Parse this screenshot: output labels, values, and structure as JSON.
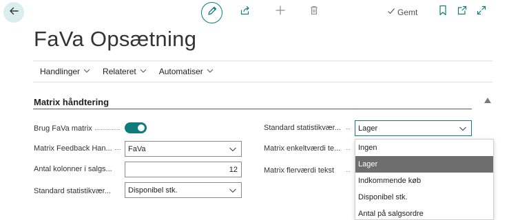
{
  "toolbar": {
    "back_icon": "arrow-left-icon",
    "edit_icon": "pencil-icon",
    "share_icon": "share-icon",
    "new_icon": "plus-icon",
    "delete_icon": "trash-icon",
    "saved_label": "Gemt",
    "bookmark_icon": "bookmark-icon",
    "open_new_window_icon": "open-in-new-window-icon",
    "expand_icon": "expand-icon"
  },
  "page": {
    "title": "FaVa Opsætning"
  },
  "action_bar": {
    "items": [
      {
        "label": "Handlinger"
      },
      {
        "label": "Relateret"
      },
      {
        "label": "Automatiser"
      }
    ]
  },
  "section": {
    "title": "Matrix håndtering"
  },
  "fields_left": [
    {
      "label": "Brug FaVa matrix",
      "type": "toggle",
      "value": true
    },
    {
      "label": "Matrix Feedback Han...",
      "type": "select",
      "value": "FaVa"
    },
    {
      "label": "Antal kolonner i salgs...",
      "type": "number",
      "value": "12"
    },
    {
      "label": "Standard statistikvær...",
      "type": "select",
      "value": "Disponibel stk."
    }
  ],
  "fields_right": [
    {
      "label": "Standard statistikvær...",
      "type": "select",
      "value": "Lager"
    },
    {
      "label": "Matrix enkeltværdi te...",
      "type": "select",
      "value": ""
    },
    {
      "label": "Matrix flerværdi tekst",
      "type": "select",
      "value": ""
    }
  ],
  "dropdown": {
    "options": [
      "Ingen",
      "Lager",
      "Indkommende køb",
      "Disponibel stk.",
      "Antal på salgsordre"
    ],
    "selected": "Lager"
  },
  "colors": {
    "accent": "#0f7b7b",
    "selected_bg": "#6e6e6e",
    "back_bg": "#dbeeee"
  }
}
